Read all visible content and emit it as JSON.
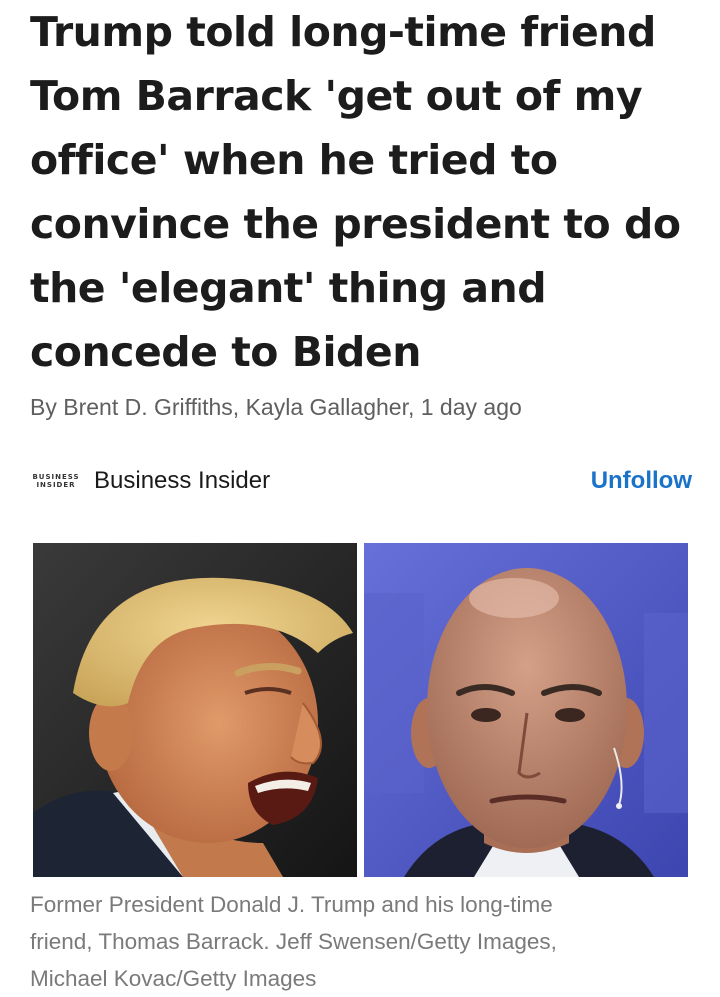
{
  "article": {
    "headline_lines": [
      "Trump told long-time friend",
      "Tom Barrack 'get out of my",
      "office' when he tried to",
      "convince the president to do",
      "the 'elegant' thing and",
      "concede to Biden"
    ],
    "byline": "By Brent D. Griffiths, Kayla Gallagher, 1 day ago"
  },
  "source": {
    "logo_line1": "BUSINESS",
    "logo_line2": "INSIDER",
    "name": "Business Insider",
    "follow_label": "Unfollow",
    "accent_color": "#1a73c8"
  },
  "photos": {
    "left_alt": "Donald Trump speaking",
    "right_alt": "Tom Barrack portrait"
  },
  "caption": {
    "lines": [
      "Former President Donald J. Trump and his long-time",
      "friend, Thomas Barrack. Jeff Swensen/Getty Images,",
      "Michael Kovac/Getty Images"
    ]
  }
}
